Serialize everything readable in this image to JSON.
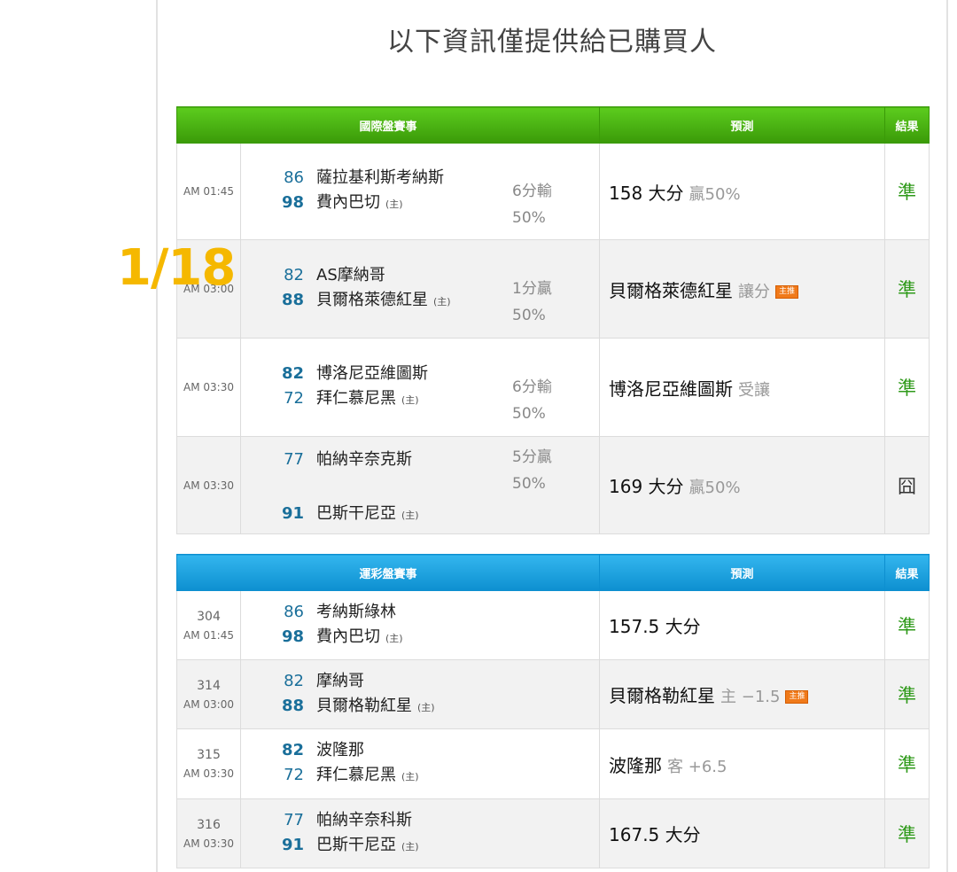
{
  "heading": "以下資訊僅提供給已購買人",
  "overlay": "1/18",
  "intl": {
    "headers": {
      "match": "國際盤賽事",
      "prediction": "預測",
      "result": "結果"
    },
    "rows": [
      {
        "time": "AM 01:45",
        "away_score": "86",
        "away": "薩拉基利斯考納斯",
        "home_score": "98",
        "home": "費內巴切",
        "home_tag": "(主)",
        "spread1": "6分輸",
        "spread2": "50%",
        "pred": "158 大分",
        "pred_note": "贏50%",
        "badge": "",
        "result": "準"
      },
      {
        "time": "AM 03:00",
        "away_score": "82",
        "away": "AS摩納哥",
        "home_score": "88",
        "home": "貝爾格萊德紅星",
        "home_tag": "(主)",
        "spread1": "1分贏",
        "spread2": "50%",
        "pred": "貝爾格萊德紅星",
        "pred_note": "讓分",
        "badge": "主推",
        "result": "準"
      },
      {
        "time": "AM 03:30",
        "away_score": "82",
        "away": "博洛尼亞維圖斯",
        "home_score": "72",
        "home": "拜仁慕尼黑",
        "home_tag": "(主)",
        "spread1": "6分輸",
        "spread2": "50%",
        "pred": "博洛尼亞維圖斯",
        "pred_note": "受讓",
        "badge": "",
        "result": "準"
      },
      {
        "time": "AM 03:30",
        "away_score": "77",
        "away": "帕納辛奈克斯",
        "home_score": "91",
        "home": "巴斯干尼亞",
        "home_tag": "(主)",
        "spread1": "5分贏",
        "spread2": "50%",
        "pred": "169 大分",
        "pred_note": "贏50%",
        "badge": "",
        "result": "囧"
      }
    ]
  },
  "lott": {
    "headers": {
      "match": "運彩盤賽事",
      "prediction": "預測",
      "result": "結果"
    },
    "rows": [
      {
        "num": "304",
        "time": "AM 01:45",
        "away_score": "86",
        "away": "考納斯綠林",
        "home_score": "98",
        "home": "費內巴切",
        "home_tag": "(主)",
        "pred": "157.5 大分",
        "pred_note": "",
        "badge": "",
        "result": "準"
      },
      {
        "num": "314",
        "time": "AM 03:00",
        "away_score": "82",
        "away": "摩納哥",
        "home_score": "88",
        "home": "貝爾格勒紅星",
        "home_tag": "(主)",
        "pred": "貝爾格勒紅星",
        "pred_note": "主 −1.5",
        "badge": "主推",
        "result": "準"
      },
      {
        "num": "315",
        "time": "AM 03:30",
        "away_score": "82",
        "away": "波隆那",
        "home_score": "72",
        "home": "拜仁慕尼黑",
        "home_tag": "(主)",
        "pred": "波隆那",
        "pred_note": "客 +6.5",
        "badge": "",
        "result": "準"
      },
      {
        "num": "316",
        "time": "AM 03:30",
        "away_score": "77",
        "away": "帕納辛奈科斯",
        "home_score": "91",
        "home": "巴斯干尼亞",
        "home_tag": "(主)",
        "pred": "167.5 大分",
        "pred_note": "",
        "badge": "",
        "result": "準"
      }
    ]
  }
}
